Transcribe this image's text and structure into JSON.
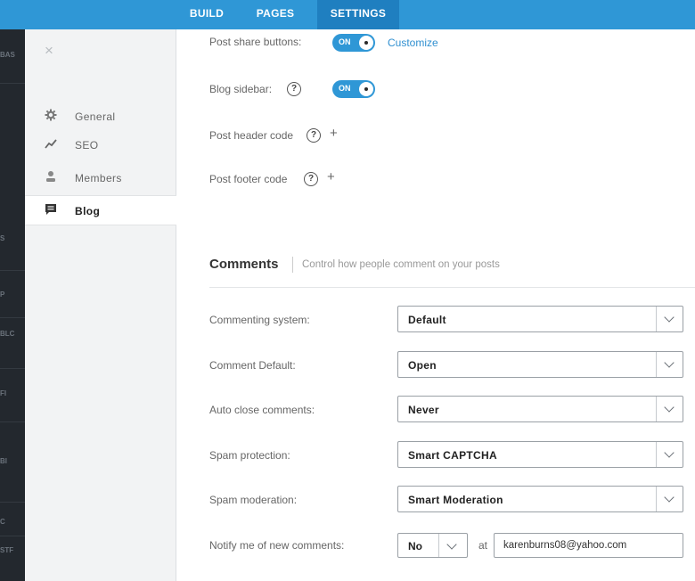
{
  "topnav": {
    "build": "BUILD",
    "pages": "PAGES",
    "settings": "SETTINGS"
  },
  "darkstrip": {
    "labels": [
      "BAS",
      "S",
      "P",
      "BLC",
      "FI",
      "Bl",
      "C",
      "STF"
    ]
  },
  "sidebar": {
    "close": "×",
    "items": [
      {
        "label": "General",
        "icon": "gear-icon"
      },
      {
        "label": "SEO",
        "icon": "trend-icon"
      },
      {
        "label": "Members",
        "icon": "person-icon"
      },
      {
        "label": "Blog",
        "icon": "comment-icon"
      }
    ]
  },
  "blog": {
    "share_label": "Post share buttons:",
    "share_toggle": "ON",
    "customize": "Customize",
    "sidebar_label": "Blog sidebar:",
    "sidebar_toggle": "ON",
    "help": "?",
    "header_code": "Post header code",
    "footer_code": "Post footer code",
    "plus": "+"
  },
  "comments": {
    "title": "Comments",
    "subtitle": "Control how people comment on your posts",
    "rows": [
      {
        "label": "Commenting system:",
        "value": "Default"
      },
      {
        "label": "Comment Default:",
        "value": "Open"
      },
      {
        "label": "Auto close comments:",
        "value": "Never"
      },
      {
        "label": "Spam protection:",
        "value": "Smart CAPTCHA"
      },
      {
        "label": "Spam moderation:",
        "value": "Smart Moderation"
      }
    ],
    "notify_label": "Notify me of new comments:",
    "notify_value": "No",
    "at": "at",
    "email": "karenburns08@yahoo.com"
  },
  "colors": {
    "accent": "#2f97d6",
    "link": "#2f8fd0",
    "dark": "#23282e"
  }
}
